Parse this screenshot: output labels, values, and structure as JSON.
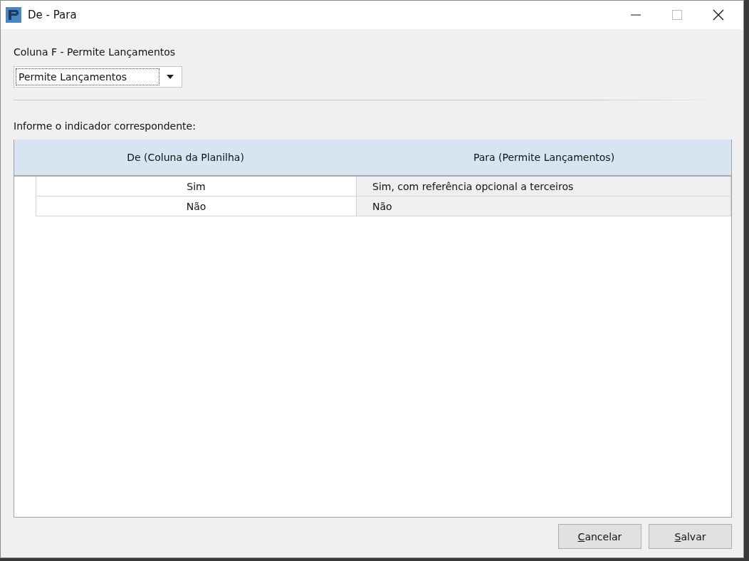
{
  "window": {
    "title": "De - Para"
  },
  "column_label": "Coluna F - Permite Lançamentos",
  "dropdown": {
    "value": "Permite Lançamentos"
  },
  "instruction": "Informe o indicador correspondente:",
  "table": {
    "columns": [
      "De (Coluna da Planilha)",
      "Para (Permite Lançamentos)"
    ],
    "rows": [
      [
        "Sim",
        "Sim, com referência opcional a terceiros"
      ],
      [
        "Não",
        "Não"
      ]
    ]
  },
  "buttons": [
    "Cancelar",
    "Salvar"
  ]
}
